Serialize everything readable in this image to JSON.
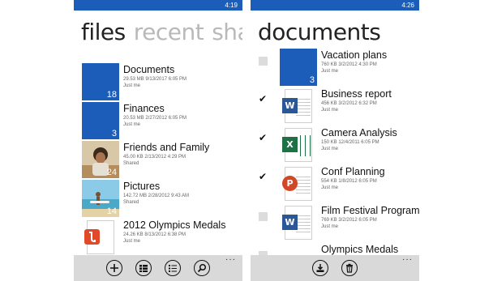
{
  "left": {
    "status": {
      "time": "4:19"
    },
    "pivots": {
      "p1": "files",
      "p2": "recent",
      "p3": "sha"
    },
    "items": [
      {
        "name": "Documents",
        "meta": "29.53 MB  9/13/2017 6:05 PM",
        "sub": "Just me",
        "count": "18"
      },
      {
        "name": "Finances",
        "meta": "20.53 MB  2/27/2012 6:05 PM",
        "sub": "Just me",
        "count": "3"
      },
      {
        "name": "Friends and Family",
        "meta": "45.00 KB  2/13/2012 4:29 PM",
        "sub": "Shared",
        "count": "24"
      },
      {
        "name": "Pictures",
        "meta": "142.72 MB  2/28/2012 9:43 AM",
        "sub": "Shared",
        "count": "14"
      },
      {
        "name": "2012 Olympics Medals",
        "meta": "24.26 KB  8/13/2012 6:38 PM",
        "sub": "Just me",
        "count": ""
      }
    ],
    "appbar": {
      "more": "···"
    }
  },
  "right": {
    "status": {
      "time": "4:26"
    },
    "title": "documents",
    "items": [
      {
        "name": "Vacation plans",
        "meta": "760 KB  3/2/2012 4:30 PM",
        "sub": "Just me",
        "count": "3",
        "checked": false
      },
      {
        "name": "Business report",
        "meta": "456 KB  3/2/2012 6:32 PM",
        "sub": "Just me",
        "checked": true
      },
      {
        "name": "Camera Analysis",
        "meta": "150 KB  12/4/2011 6:05 PM",
        "sub": "Just me",
        "checked": true
      },
      {
        "name": "Conf Planning",
        "meta": "554 KB  1/8/2012 6:05 PM",
        "sub": "Just me",
        "checked": true
      },
      {
        "name": "Film Festival Program",
        "meta": "769 KB  3/2/2012 6:05 PM",
        "sub": "Just me",
        "checked": false
      },
      {
        "name": "Olympics Medals",
        "meta": "",
        "sub": "",
        "checked": false
      }
    ],
    "appbar": {
      "more": "···"
    }
  },
  "colors": {
    "accent": "#1b5db8",
    "word": "#2b5797",
    "excel": "#1e7145",
    "ppt": "#d24726",
    "pdf": "#e04a2a"
  }
}
